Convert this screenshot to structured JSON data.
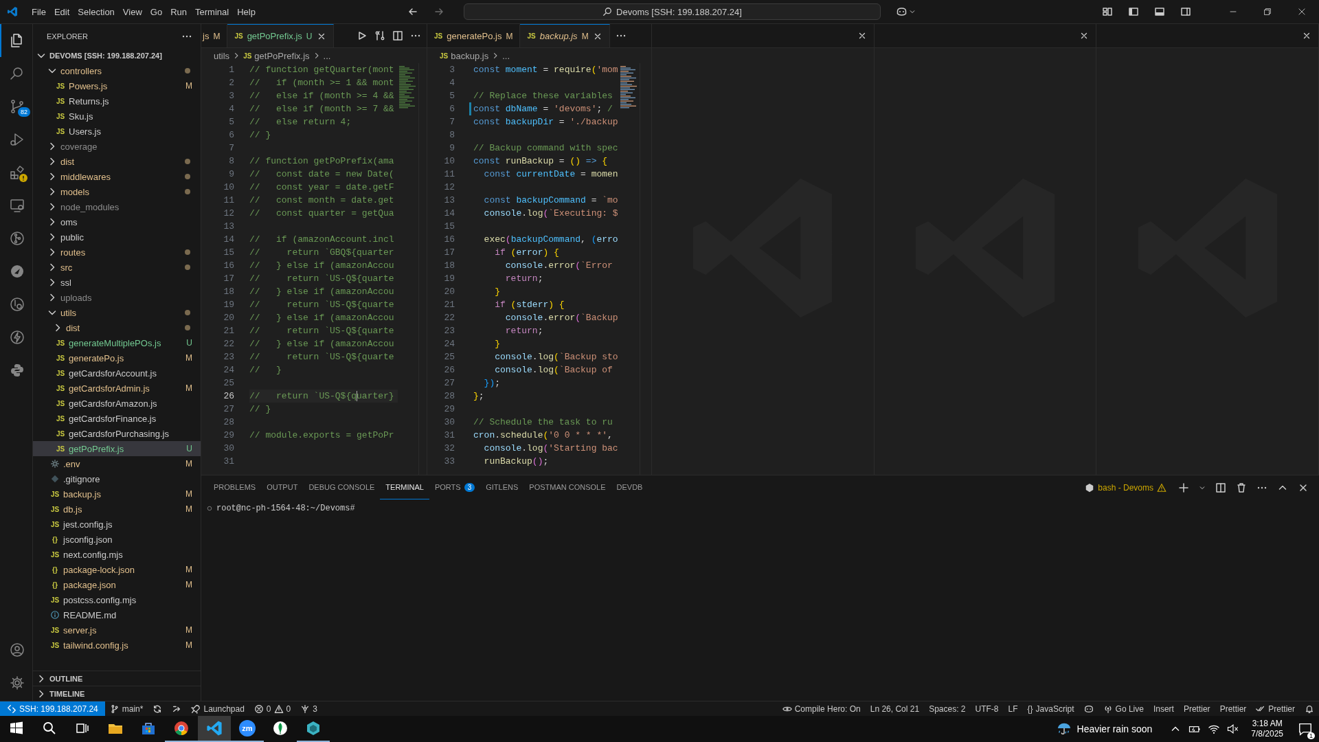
{
  "title_bar": {
    "menu": [
      "File",
      "Edit",
      "Selection",
      "View",
      "Go",
      "Run",
      "Terminal",
      "Help"
    ],
    "command_center": "Devoms [SSH: 199.188.207.24]"
  },
  "activity_bar": {
    "items": [
      {
        "selected": true,
        "warning": false
      },
      {
        "selected": false,
        "warning": false
      },
      {
        "selected": false,
        "warning": false,
        "badge": "82"
      },
      {
        "selected": false,
        "warning": false
      },
      {
        "selected": false,
        "warning": true
      },
      {
        "selected": false,
        "warning": false
      },
      {
        "selected": false,
        "warning": false
      },
      {
        "selected": false,
        "warning": false
      },
      {
        "selected": false,
        "warning": false
      },
      {
        "selected": false,
        "warning": false
      },
      {
        "selected": false,
        "warning": false
      }
    ],
    "bottom": [
      {
        "selected": false,
        "warning": false
      },
      {
        "selected": false,
        "warning": false
      }
    ]
  },
  "sidebar": {
    "title": "EXPLORER",
    "root": {
      "label": "DEVOMS [SSH: 199.188.207.24]",
      "expanded": true,
      "children": [
        {
          "label": "controllers",
          "kind": "folder",
          "expanded": true,
          "color": "#e2c08d",
          "dot": true,
          "selected": false,
          "children": [
            {
              "label": "Powers.js",
              "kind": "file",
              "glyph": "JS",
              "color": "#e2c08d",
              "badge": "M",
              "selected": false
            },
            {
              "label": "Returns.js",
              "kind": "file",
              "glyph": "JS",
              "color": "#cccccc",
              "selected": false
            },
            {
              "label": "Sku.js",
              "kind": "file",
              "glyph": "JS",
              "color": "#cccccc",
              "selected": false
            },
            {
              "label": "Users.js",
              "kind": "file",
              "glyph": "JS",
              "color": "#cccccc",
              "selected": false
            }
          ]
        },
        {
          "label": "coverage",
          "kind": "folder",
          "expanded": false,
          "color": "#8c8c8c",
          "dot": false,
          "selected": false
        },
        {
          "label": "dist",
          "kind": "folder",
          "expanded": false,
          "color": "#e2c08d",
          "dot": true,
          "selected": false
        },
        {
          "label": "middlewares",
          "kind": "folder",
          "expanded": false,
          "color": "#e2c08d",
          "dot": true,
          "selected": false
        },
        {
          "label": "models",
          "kind": "folder",
          "expanded": false,
          "color": "#e2c08d",
          "dot": true,
          "selected": false
        },
        {
          "label": "node_modules",
          "kind": "folder",
          "expanded": false,
          "color": "#8c8c8c",
          "dot": false,
          "selected": false
        },
        {
          "label": "oms",
          "kind": "folder",
          "expanded": false,
          "color": "#cccccc",
          "dot": false,
          "selected": false
        },
        {
          "label": "public",
          "kind": "folder",
          "expanded": false,
          "color": "#cccccc",
          "dot": false,
          "selected": false
        },
        {
          "label": "routes",
          "kind": "folder",
          "expanded": false,
          "color": "#e2c08d",
          "dot": true,
          "selected": false
        },
        {
          "label": "src",
          "kind": "folder",
          "expanded": false,
          "color": "#e2c08d",
          "dot": true,
          "selected": false
        },
        {
          "label": "ssl",
          "kind": "folder",
          "expanded": false,
          "color": "#cccccc",
          "dot": false,
          "selected": false
        },
        {
          "label": "uploads",
          "kind": "folder",
          "expanded": false,
          "color": "#8c8c8c",
          "dot": false,
          "selected": false
        },
        {
          "label": "utils",
          "kind": "folder",
          "expanded": true,
          "color": "#e2c08d",
          "dot": true,
          "selected": false,
          "children": [
            {
              "label": "dist",
              "kind": "folder",
              "expanded": false,
              "color": "#e2c08d",
              "dot": true,
              "selected": false
            },
            {
              "label": "generateMultiplePOs.js",
              "kind": "file",
              "glyph": "JS",
              "color": "#73c991",
              "badge": "U",
              "selected": false
            },
            {
              "label": "generatePo.js",
              "kind": "file",
              "glyph": "JS",
              "color": "#e2c08d",
              "badge": "M",
              "selected": false
            },
            {
              "label": "getCardsforAccount.js",
              "kind": "file",
              "glyph": "JS",
              "color": "#cccccc",
              "selected": false
            },
            {
              "label": "getCardsforAdmin.js",
              "kind": "file",
              "glyph": "JS",
              "color": "#e2c08d",
              "badge": "M",
              "selected": false
            },
            {
              "label": "getCardsforAmazon.js",
              "kind": "file",
              "glyph": "JS",
              "color": "#cccccc",
              "selected": false
            },
            {
              "label": "getCardsforFinance.js",
              "kind": "file",
              "glyph": "JS",
              "color": "#cccccc",
              "selected": false
            },
            {
              "label": "getCardsforPurchasing.js",
              "kind": "file",
              "glyph": "JS",
              "color": "#cccccc",
              "selected": false
            },
            {
              "label": "getPoPrefix.js",
              "kind": "file",
              "glyph": "JS",
              "color": "#73c991",
              "badge": "U",
              "selected": true
            }
          ]
        },
        {
          "label": ".env",
          "kind": "env",
          "color": "#e2c08d",
          "badge": "M",
          "selected": false
        },
        {
          "label": ".gitignore",
          "kind": "gitignore",
          "color": "#cccccc",
          "selected": false
        },
        {
          "label": "backup.js",
          "kind": "file",
          "glyph": "JS",
          "color": "#e2c08d",
          "badge": "M",
          "selected": false
        },
        {
          "label": "db.js",
          "kind": "file",
          "glyph": "JS",
          "color": "#e2c08d",
          "badge": "M",
          "selected": false
        },
        {
          "label": "jest.config.js",
          "kind": "file",
          "glyph": "JS",
          "color": "#cccccc",
          "selected": false
        },
        {
          "label": "jsconfig.json",
          "kind": "file",
          "glyph": "{}",
          "color": "#cccccc",
          "selected": false
        },
        {
          "label": "next.config.mjs",
          "kind": "file",
          "glyph": "JS",
          "color": "#cccccc",
          "selected": false
        },
        {
          "label": "package-lock.json",
          "kind": "file",
          "glyph": "{}",
          "color": "#e2c08d",
          "badge": "M",
          "selected": false
        },
        {
          "label": "package.json",
          "kind": "file",
          "glyph": "{}",
          "color": "#e2c08d",
          "badge": "M",
          "selected": false
        },
        {
          "label": "postcss.config.mjs",
          "kind": "file",
          "glyph": "JS",
          "color": "#cccccc",
          "selected": false
        },
        {
          "label": "README.md",
          "kind": "readme",
          "color": "#cccccc",
          "selected": false
        },
        {
          "label": "server.js",
          "kind": "file",
          "glyph": "JS",
          "color": "#e2c08d",
          "badge": "M",
          "selected": false
        },
        {
          "label": "tailwind.config.js",
          "kind": "file",
          "glyph": "JS",
          "color": "#e2c08d",
          "badge": "M",
          "selected": false
        }
      ]
    },
    "sections": [
      {
        "label": "OUTLINE",
        "expanded": false
      },
      {
        "label": "TIMELINE",
        "expanded": false
      }
    ]
  },
  "editor_groups": [
    {
      "kind": "editor",
      "tabs": [
        {
          "label": "js",
          "badge": "M",
          "color": "#e2c08d",
          "selected": false,
          "preview": false
        },
        {
          "label": "getPoPrefix.js",
          "glyph": "JS",
          "badge": "U",
          "color": "#73c991",
          "selected": true,
          "preview": false
        }
      ],
      "breadcrumb": [
        {
          "text": "utils"
        },
        {
          "text": "getPoPrefix.js",
          "glyph": "JS"
        },
        {
          "text": "..."
        }
      ],
      "lines": [
        {
          "n": "1",
          "current": false,
          "code": [
            {
              "text": "// function getQuarter(mont",
              "kind": "comment"
            }
          ]
        },
        {
          "n": "2",
          "current": false,
          "code": [
            {
              "text": "//   if (month >= 1 && mont",
              "kind": "comment"
            }
          ]
        },
        {
          "n": "3",
          "current": false,
          "code": [
            {
              "text": "//   else if (month >= 4 &&",
              "kind": "comment"
            }
          ]
        },
        {
          "n": "4",
          "current": false,
          "code": [
            {
              "text": "//   else if (month >= 7 &&",
              "kind": "comment"
            }
          ]
        },
        {
          "n": "5",
          "current": false,
          "code": [
            {
              "text": "//   else return 4;",
              "kind": "comment"
            }
          ]
        },
        {
          "n": "6",
          "current": false,
          "code": [
            {
              "text": "// }",
              "kind": "comment"
            }
          ]
        },
        {
          "n": "7",
          "current": false
        },
        {
          "n": "8",
          "current": false,
          "code": [
            {
              "text": "// function getPoPrefix(ama",
              "kind": "comment"
            }
          ]
        },
        {
          "n": "9",
          "current": false,
          "code": [
            {
              "text": "//   const date = new Date(",
              "kind": "comment"
            }
          ]
        },
        {
          "n": "10",
          "current": false,
          "code": [
            {
              "text": "//   const year = date.getF",
              "kind": "comment"
            }
          ]
        },
        {
          "n": "11",
          "current": false,
          "code": [
            {
              "text": "//   const month = date.get",
              "kind": "comment"
            }
          ]
        },
        {
          "n": "12",
          "current": false,
          "code": [
            {
              "text": "//   const quarter = getQua",
              "kind": "comment"
            }
          ]
        },
        {
          "n": "13",
          "current": false
        },
        {
          "n": "14",
          "current": false,
          "code": [
            {
              "text": "//   if (amazonAccount.incl",
              "kind": "comment"
            }
          ]
        },
        {
          "n": "15",
          "current": false,
          "code": [
            {
              "text": "//     return `GBQ${quarter",
              "kind": "comment"
            }
          ]
        },
        {
          "n": "16",
          "current": false,
          "code": [
            {
              "text": "//   } else if (amazonAccou",
              "kind": "comment"
            }
          ]
        },
        {
          "n": "17",
          "current": false,
          "code": [
            {
              "text": "//     return `US-Q${quarte",
              "kind": "comment"
            }
          ]
        },
        {
          "n": "18",
          "current": false,
          "code": [
            {
              "text": "//   } else if (amazonAccou",
              "kind": "comment"
            }
          ]
        },
        {
          "n": "19",
          "current": false,
          "code": [
            {
              "text": "//     return `US-Q${quarte",
              "kind": "comment"
            }
          ]
        },
        {
          "n": "20",
          "current": false,
          "code": [
            {
              "text": "//   } else if (amazonAccou",
              "kind": "comment"
            }
          ]
        },
        {
          "n": "21",
          "current": false,
          "code": [
            {
              "text": "//     return `US-Q${quarte",
              "kind": "comment"
            }
          ]
        },
        {
          "n": "22",
          "current": false,
          "code": [
            {
              "text": "//   } else if (amazonAccou",
              "kind": "comment"
            }
          ]
        },
        {
          "n": "23",
          "current": false,
          "code": [
            {
              "text": "//     return `US-Q${quarte",
              "kind": "comment"
            }
          ]
        },
        {
          "n": "24",
          "current": false,
          "code": [
            {
              "text": "//   }",
              "kind": "comment"
            }
          ]
        },
        {
          "n": "25",
          "current": false
        },
        {
          "n": "26",
          "current": true,
          "code": [
            {
              "text": "//   return `US-Q${quarter}",
              "kind": "comment"
            }
          ]
        },
        {
          "n": "27",
          "current": false,
          "code": [
            {
              "text": "// }",
              "kind": "comment"
            }
          ]
        },
        {
          "n": "28",
          "current": false
        },
        {
          "n": "29",
          "current": false,
          "code": [
            {
              "text": "// module.exports = getPoPr",
              "kind": "comment"
            }
          ]
        },
        {
          "n": "30",
          "current": false
        },
        {
          "n": "31",
          "current": false
        }
      ]
    },
    {
      "kind": "editor",
      "tabs": [
        {
          "label": "generatePo.js",
          "glyph": "JS",
          "badge": "M",
          "color": "#e2c08d",
          "selected": false,
          "preview": false
        },
        {
          "label": "backup.js",
          "glyph": "JS",
          "badge": "M",
          "color": "#e2c08d",
          "selected": true,
          "preview": true
        }
      ],
      "breadcrumb": [
        {
          "text": "backup.js",
          "glyph": "JS"
        },
        {
          "text": "..."
        }
      ],
      "lines": [
        {
          "n": "3",
          "changed": false,
          "code": [
            {
              "text": "const",
              "kind": "keyword"
            },
            {
              "text": " moment",
              "kind": "constant"
            },
            {
              "text": " = ",
              "kind": "plain"
            },
            {
              "text": "require",
              "kind": "function"
            },
            {
              "text": "(",
              "kind": "bracket"
            },
            {
              "text": "'mom",
              "kind": "string"
            }
          ]
        },
        {
          "n": "4",
          "changed": false
        },
        {
          "n": "5",
          "changed": false,
          "code": [
            {
              "text": "// Replace these variables",
              "kind": "comment"
            }
          ]
        },
        {
          "n": "6",
          "changed": true,
          "code": [
            {
              "text": "const",
              "kind": "keyword"
            },
            {
              "text": " dbName",
              "kind": "constant"
            },
            {
              "text": " = ",
              "kind": "plain"
            },
            {
              "text": "'devoms'",
              "kind": "string"
            },
            {
              "text": "; ",
              "kind": "plain"
            },
            {
              "text": "/",
              "kind": "comment"
            }
          ]
        },
        {
          "n": "7",
          "changed": false,
          "code": [
            {
              "text": "const",
              "kind": "keyword"
            },
            {
              "text": " backupDir",
              "kind": "constant"
            },
            {
              "text": " = ",
              "kind": "plain"
            },
            {
              "text": "'./backup",
              "kind": "string"
            }
          ]
        },
        {
          "n": "8",
          "changed": false
        },
        {
          "n": "9",
          "changed": false,
          "code": [
            {
              "text": "// Backup command with spec",
              "kind": "comment"
            }
          ]
        },
        {
          "n": "10",
          "changed": false,
          "code": [
            {
              "text": "const",
              "kind": "keyword"
            },
            {
              "text": " runBackup",
              "kind": "function"
            },
            {
              "text": " = ",
              "kind": "plain"
            },
            {
              "text": "()",
              "kind": "bracket"
            },
            {
              "text": " =>",
              "kind": "keyword"
            },
            {
              "text": " {",
              "kind": "bracket"
            }
          ]
        },
        {
          "n": "11",
          "changed": false,
          "code": [
            {
              "text": "  const",
              "kind": "keyword"
            },
            {
              "text": " currentDate",
              "kind": "constant"
            },
            {
              "text": " = ",
              "kind": "plain"
            },
            {
              "text": "momen",
              "kind": "function"
            }
          ]
        },
        {
          "n": "12",
          "changed": false
        },
        {
          "n": "13",
          "changed": false,
          "code": [
            {
              "text": "  const",
              "kind": "keyword"
            },
            {
              "text": " backupCommand",
              "kind": "constant"
            },
            {
              "text": " = ",
              "kind": "plain"
            },
            {
              "text": "`mo",
              "kind": "string"
            }
          ]
        },
        {
          "n": "14",
          "changed": false,
          "code": [
            {
              "text": "  console",
              "kind": "variable"
            },
            {
              "text": ".",
              "kind": "plain"
            },
            {
              "text": "log",
              "kind": "function"
            },
            {
              "text": "(",
              "kind": "bracket2"
            },
            {
              "text": "`Executing: $",
              "kind": "string"
            }
          ]
        },
        {
          "n": "15",
          "changed": false
        },
        {
          "n": "16",
          "changed": false,
          "code": [
            {
              "text": "  exec",
              "kind": "function"
            },
            {
              "text": "(",
              "kind": "bracket2"
            },
            {
              "text": "backupCommand",
              "kind": "constant"
            },
            {
              "text": ", ",
              "kind": "plain"
            },
            {
              "text": "(",
              "kind": "bracket3"
            },
            {
              "text": "erro",
              "kind": "variable"
            }
          ]
        },
        {
          "n": "17",
          "changed": false,
          "code": [
            {
              "text": "    if",
              "kind": "control"
            },
            {
              "text": " (",
              "kind": "bracket"
            },
            {
              "text": "error",
              "kind": "variable"
            },
            {
              "text": ")",
              "kind": "bracket"
            },
            {
              "text": " {",
              "kind": "bracket"
            }
          ]
        },
        {
          "n": "18",
          "changed": false,
          "code": [
            {
              "text": "      console",
              "kind": "variable"
            },
            {
              "text": ".",
              "kind": "plain"
            },
            {
              "text": "error",
              "kind": "function"
            },
            {
              "text": "(",
              "kind": "bracket2"
            },
            {
              "text": "`Error",
              "kind": "string"
            }
          ]
        },
        {
          "n": "19",
          "changed": false,
          "code": [
            {
              "text": "      return",
              "kind": "control"
            },
            {
              "text": ";",
              "kind": "plain"
            }
          ]
        },
        {
          "n": "20",
          "changed": false,
          "code": [
            {
              "text": "    }",
              "kind": "bracket"
            }
          ]
        },
        {
          "n": "21",
          "changed": false,
          "code": [
            {
              "text": "    if",
              "kind": "control"
            },
            {
              "text": " (",
              "kind": "bracket"
            },
            {
              "text": "stderr",
              "kind": "variable"
            },
            {
              "text": ")",
              "kind": "bracket"
            },
            {
              "text": " {",
              "kind": "bracket"
            }
          ]
        },
        {
          "n": "22",
          "changed": false,
          "code": [
            {
              "text": "      console",
              "kind": "variable"
            },
            {
              "text": ".",
              "kind": "plain"
            },
            {
              "text": "error",
              "kind": "function"
            },
            {
              "text": "(",
              "kind": "bracket2"
            },
            {
              "text": "`Backup",
              "kind": "string"
            }
          ]
        },
        {
          "n": "23",
          "changed": false,
          "code": [
            {
              "text": "      return",
              "kind": "control"
            },
            {
              "text": ";",
              "kind": "plain"
            }
          ]
        },
        {
          "n": "24",
          "changed": false,
          "code": [
            {
              "text": "    }",
              "kind": "bracket"
            }
          ]
        },
        {
          "n": "25",
          "changed": false,
          "code": [
            {
              "text": "    console",
              "kind": "variable"
            },
            {
              "text": ".",
              "kind": "plain"
            },
            {
              "text": "log",
              "kind": "function"
            },
            {
              "text": "(",
              "kind": "bracket"
            },
            {
              "text": "`Backup sto",
              "kind": "string"
            }
          ]
        },
        {
          "n": "26",
          "changed": false,
          "code": [
            {
              "text": "    console",
              "kind": "variable"
            },
            {
              "text": ".",
              "kind": "plain"
            },
            {
              "text": "log",
              "kind": "function"
            },
            {
              "text": "(",
              "kind": "bracket"
            },
            {
              "text": "`Backup of",
              "kind": "string"
            }
          ]
        },
        {
          "n": "27",
          "changed": false,
          "code": [
            {
              "text": "  })",
              "kind": "bracket3"
            },
            {
              "text": ";",
              "kind": "plain"
            }
          ]
        },
        {
          "n": "28",
          "changed": false,
          "code": [
            {
              "text": "}",
              "kind": "bracket"
            },
            {
              "text": ";",
              "kind": "plain"
            }
          ]
        },
        {
          "n": "29",
          "changed": false
        },
        {
          "n": "30",
          "changed": false,
          "code": [
            {
              "text": "// Schedule the task to ru",
              "kind": "comment"
            }
          ]
        },
        {
          "n": "31",
          "changed": false,
          "code": [
            {
              "text": "cron",
              "kind": "variable"
            },
            {
              "text": ".",
              "kind": "plain"
            },
            {
              "text": "schedule",
              "kind": "function"
            },
            {
              "text": "(",
              "kind": "bracket"
            },
            {
              "text": "'0 0 * * *'",
              "kind": "string"
            },
            {
              "text": ",",
              "kind": "plain"
            }
          ]
        },
        {
          "n": "32",
          "changed": false,
          "code": [
            {
              "text": "  console",
              "kind": "variable"
            },
            {
              "text": ".",
              "kind": "plain"
            },
            {
              "text": "log",
              "kind": "function"
            },
            {
              "text": "(",
              "kind": "bracket2"
            },
            {
              "text": "'Starting bac",
              "kind": "string"
            }
          ]
        },
        {
          "n": "33",
          "changed": false,
          "code": [
            {
              "text": "  runBackup",
              "kind": "function"
            },
            {
              "text": "()",
              "kind": "bracket2"
            },
            {
              "text": ";",
              "kind": "plain"
            }
          ]
        }
      ]
    },
    {
      "kind": "empty"
    },
    {
      "kind": "empty"
    },
    {
      "kind": "empty"
    }
  ],
  "panel": {
    "tabs": [
      {
        "label": "PROBLEMS",
        "selected": false
      },
      {
        "label": "OUTPUT",
        "selected": false
      },
      {
        "label": "DEBUG CONSOLE",
        "selected": false
      },
      {
        "label": "TERMINAL",
        "selected": true
      },
      {
        "label": "PORTS",
        "selected": false,
        "badge": "3"
      },
      {
        "label": "GITLENS",
        "selected": false
      },
      {
        "label": "POSTMAN CONSOLE",
        "selected": false
      },
      {
        "label": "DEVDB",
        "selected": false
      }
    ],
    "terminal_name": "bash - Devoms",
    "terminal_lines": [
      "root@nc-ph-1564-48:~/Devoms#"
    ]
  },
  "status_bar": {
    "left": [
      {
        "kind": "remote",
        "text": "SSH: 199.188.207.24"
      },
      {
        "kind": "branch",
        "text": "main*"
      },
      {
        "kind": "sync"
      },
      {
        "kind": "live-share"
      },
      {
        "kind": "launchpad",
        "text": "Launchpad"
      },
      {
        "kind": "problems",
        "errors": "0",
        "warnings": "0"
      },
      {
        "kind": "ports",
        "text": "3"
      }
    ],
    "right": [
      {
        "kind": "eye",
        "text": "Compile Hero: On"
      },
      {
        "kind": "text",
        "text": "Ln 26, Col 21"
      },
      {
        "kind": "text",
        "text": "Spaces: 2"
      },
      {
        "kind": "text",
        "text": "UTF-8"
      },
      {
        "kind": "text",
        "text": "LF"
      },
      {
        "kind": "language",
        "glyph": "{}",
        "text": "JavaScript"
      },
      {
        "kind": "copilot"
      },
      {
        "kind": "broadcast",
        "text": "Go Live"
      },
      {
        "kind": "text",
        "text": "Insert"
      },
      {
        "kind": "text",
        "text": "Prettier"
      },
      {
        "kind": "text",
        "text": "Prettier"
      },
      {
        "kind": "check",
        "text": "Prettier"
      },
      {
        "kind": "bell"
      }
    ]
  },
  "taskbar": {
    "apps": [
      {
        "kind": "start",
        "running": false,
        "selected": false
      },
      {
        "kind": "search",
        "running": false,
        "selected": false
      },
      {
        "kind": "task-view",
        "running": false,
        "selected": false
      },
      {
        "kind": "folder",
        "running": false,
        "selected": false
      },
      {
        "kind": "store",
        "running": false,
        "selected": false
      },
      {
        "kind": "browser",
        "running": true,
        "selected": false
      },
      {
        "kind": "editor",
        "running": true,
        "selected": true
      },
      {
        "kind": "video",
        "glyph": "zm",
        "running": true,
        "selected": false
      },
      {
        "kind": "leaf",
        "running": false,
        "selected": false
      },
      {
        "kind": "hexagon",
        "running": true,
        "selected": false
      }
    ],
    "weather": "Heavier rain soon",
    "time": "3:18 AM",
    "date": "7/8/2025",
    "notifications": "1"
  }
}
